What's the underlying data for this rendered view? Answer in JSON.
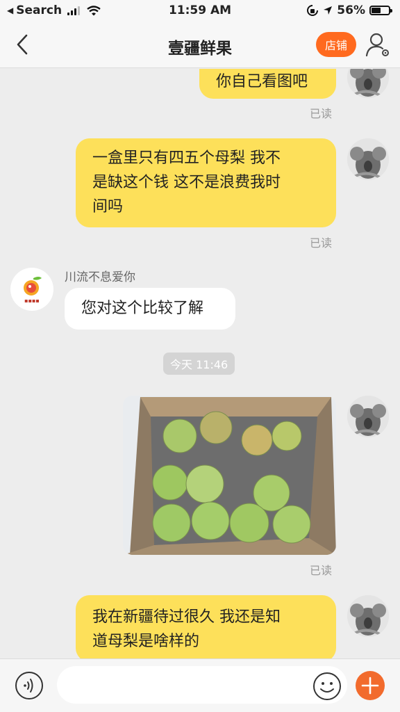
{
  "status_bar": {
    "back_app": "Search",
    "time": "11:59 AM",
    "battery": "56%",
    "battery_level": 0.56
  },
  "header": {
    "title": "壹疆鲜果",
    "store_button": "店铺"
  },
  "messages": {
    "msg1": {
      "text": "你自己看图吧",
      "status": "已读"
    },
    "msg2": {
      "line1": "一盒里只有四五个母梨  我不",
      "line2": "是缺这个钱  这不是浪费我时",
      "line3": "间吗",
      "status": "已读"
    },
    "msg3": {
      "sender": "川流不息爱你",
      "text": "您对这个比较了解"
    },
    "timestamp": "今天 11:46",
    "msg4": {
      "status": "已读"
    },
    "msg5": {
      "line1": "我在新疆待过很久  我还是知",
      "line2": "道母梨是啥样的"
    }
  },
  "input_bar": {
    "placeholder": ""
  },
  "colors": {
    "outgoing_bubble": "#fde05a",
    "incoming_bubble": "#ffffff",
    "accent": "#ff6a1f"
  }
}
